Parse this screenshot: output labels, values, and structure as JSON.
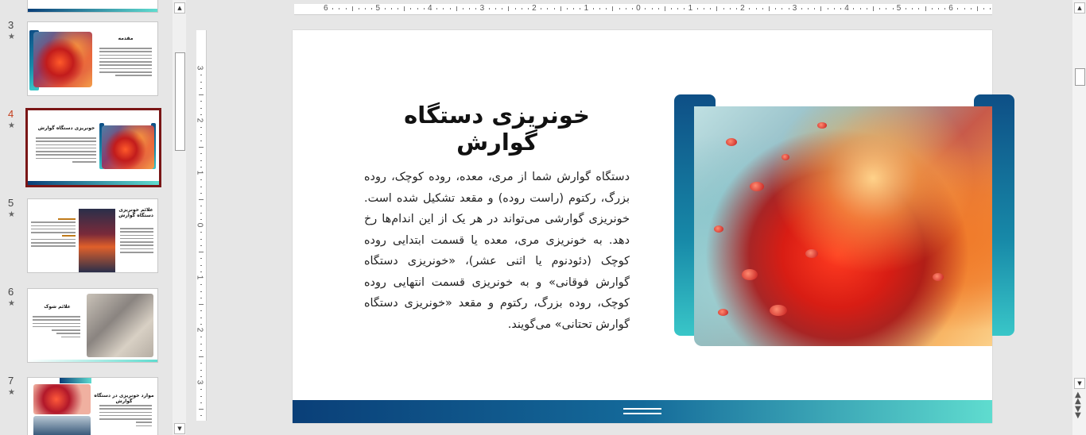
{
  "thumbnails": [
    {
      "number": "3",
      "title": "مقدمه"
    },
    {
      "number": "4",
      "title": "خونریزی دستگاه گوارش"
    },
    {
      "number": "5",
      "title": "علائم خونریزی دستگاه گوارش"
    },
    {
      "number": "6",
      "title": "علائم شوک"
    },
    {
      "number": "7",
      "title": "موارد خونریزی در دستگاه گوارش"
    }
  ],
  "rulers": {
    "horizontal": [
      "6",
      "5",
      "4",
      "3",
      "2",
      "1",
      "0",
      "1",
      "2",
      "3",
      "4",
      "5",
      "6"
    ],
    "vertical": [
      "3",
      "2",
      "1",
      "0",
      "1",
      "2",
      "3"
    ]
  },
  "slide": {
    "title": "خونریزی دستگاه گوارش",
    "body": "دستگاه گوارش شما از مری، معده، روده کوچک، روده بزرگ، رکتوم (راست روده) و مقعد تشکیل شده است. خونریزی گوارشی می‌تواند در هر یک از این اندام‌ها رخ دهد. به خونریزی مری، معده یا قسمت ابتدایی روده کوچک (دئودنوم یا اثنی عشر)، «خونریزی دستگاه گوارش فوقانی» و به خونریزی قسمت انتهایی روده کوچک، روده بزرگ، رکتوم و مقعد «خونریزی دستگاه گوارش تحتانی» می‌گویند."
  },
  "colors": {
    "accent_dark": "#0e4f86",
    "accent_light": "#5fdccf",
    "selection": "#7a1616",
    "slide_number_active": "#c43e1c"
  },
  "icons": {
    "star": "star-icon",
    "scroll_up": "arrow-up-icon",
    "scroll_down": "arrow-down-icon",
    "prev_slide": "previous-slide-icon",
    "next_slide": "next-slide-icon"
  }
}
